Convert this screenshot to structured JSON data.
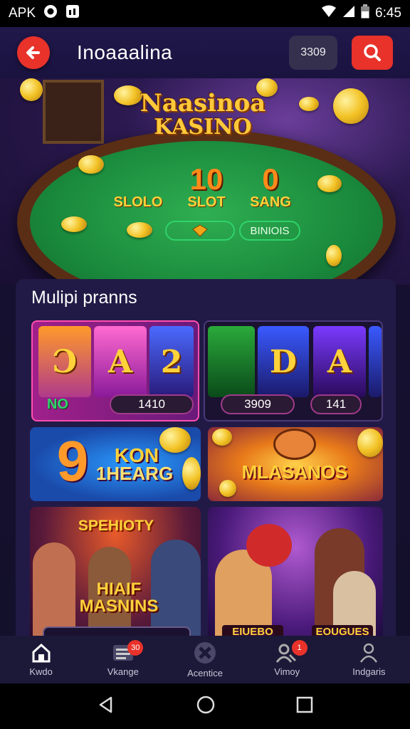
{
  "status_bar": {
    "left_text": "APK",
    "time": "6:45"
  },
  "app_bar": {
    "title": "Inoaaalina",
    "balance": "3309",
    "back_icon": "back-arrow-icon",
    "search_icon": "search-icon",
    "accent_color": "#e8322a"
  },
  "hero": {
    "title_line1": "Naasinoa",
    "title_line2": "KASINO",
    "chips": [
      {
        "big": "",
        "label": "SLOLO"
      },
      {
        "big": "10",
        "label": "SLOT"
      },
      {
        "big": "0",
        "label": "SANG"
      }
    ],
    "pill_text": "BINIOIS"
  },
  "section": {
    "title": "Mulipi pranns"
  },
  "slot_tiles": [
    {
      "reels": [
        "Ɔ",
        "A",
        "2"
      ],
      "badge": "NO",
      "readout": "1410"
    },
    {
      "reels": [
        "",
        "D",
        "A",
        ""
      ],
      "readout": "3909",
      "readout2": "141"
    }
  ],
  "banners": [
    {
      "big": "9",
      "line1": "KON",
      "line2": "1HEARG"
    },
    {
      "text": "MLASANOS"
    }
  ],
  "posters": [
    {
      "top": "SPEHIOTY",
      "line1": "HIAIF",
      "line2": "MASNINS"
    },
    {
      "label_left": "EIUEBO",
      "label_right": "EOUGUES"
    }
  ],
  "bottom_nav": [
    {
      "label": "Kwdo",
      "icon": "home-icon",
      "badge": ""
    },
    {
      "label": "Vkange",
      "icon": "list-icon",
      "badge": "30"
    },
    {
      "label": "Acentice",
      "icon": "casino-chip-icon",
      "badge": ""
    },
    {
      "label": "Vimoy",
      "icon": "user-search-icon",
      "badge": "1"
    },
    {
      "label": "Indgaris",
      "icon": "profile-icon",
      "badge": ""
    }
  ]
}
